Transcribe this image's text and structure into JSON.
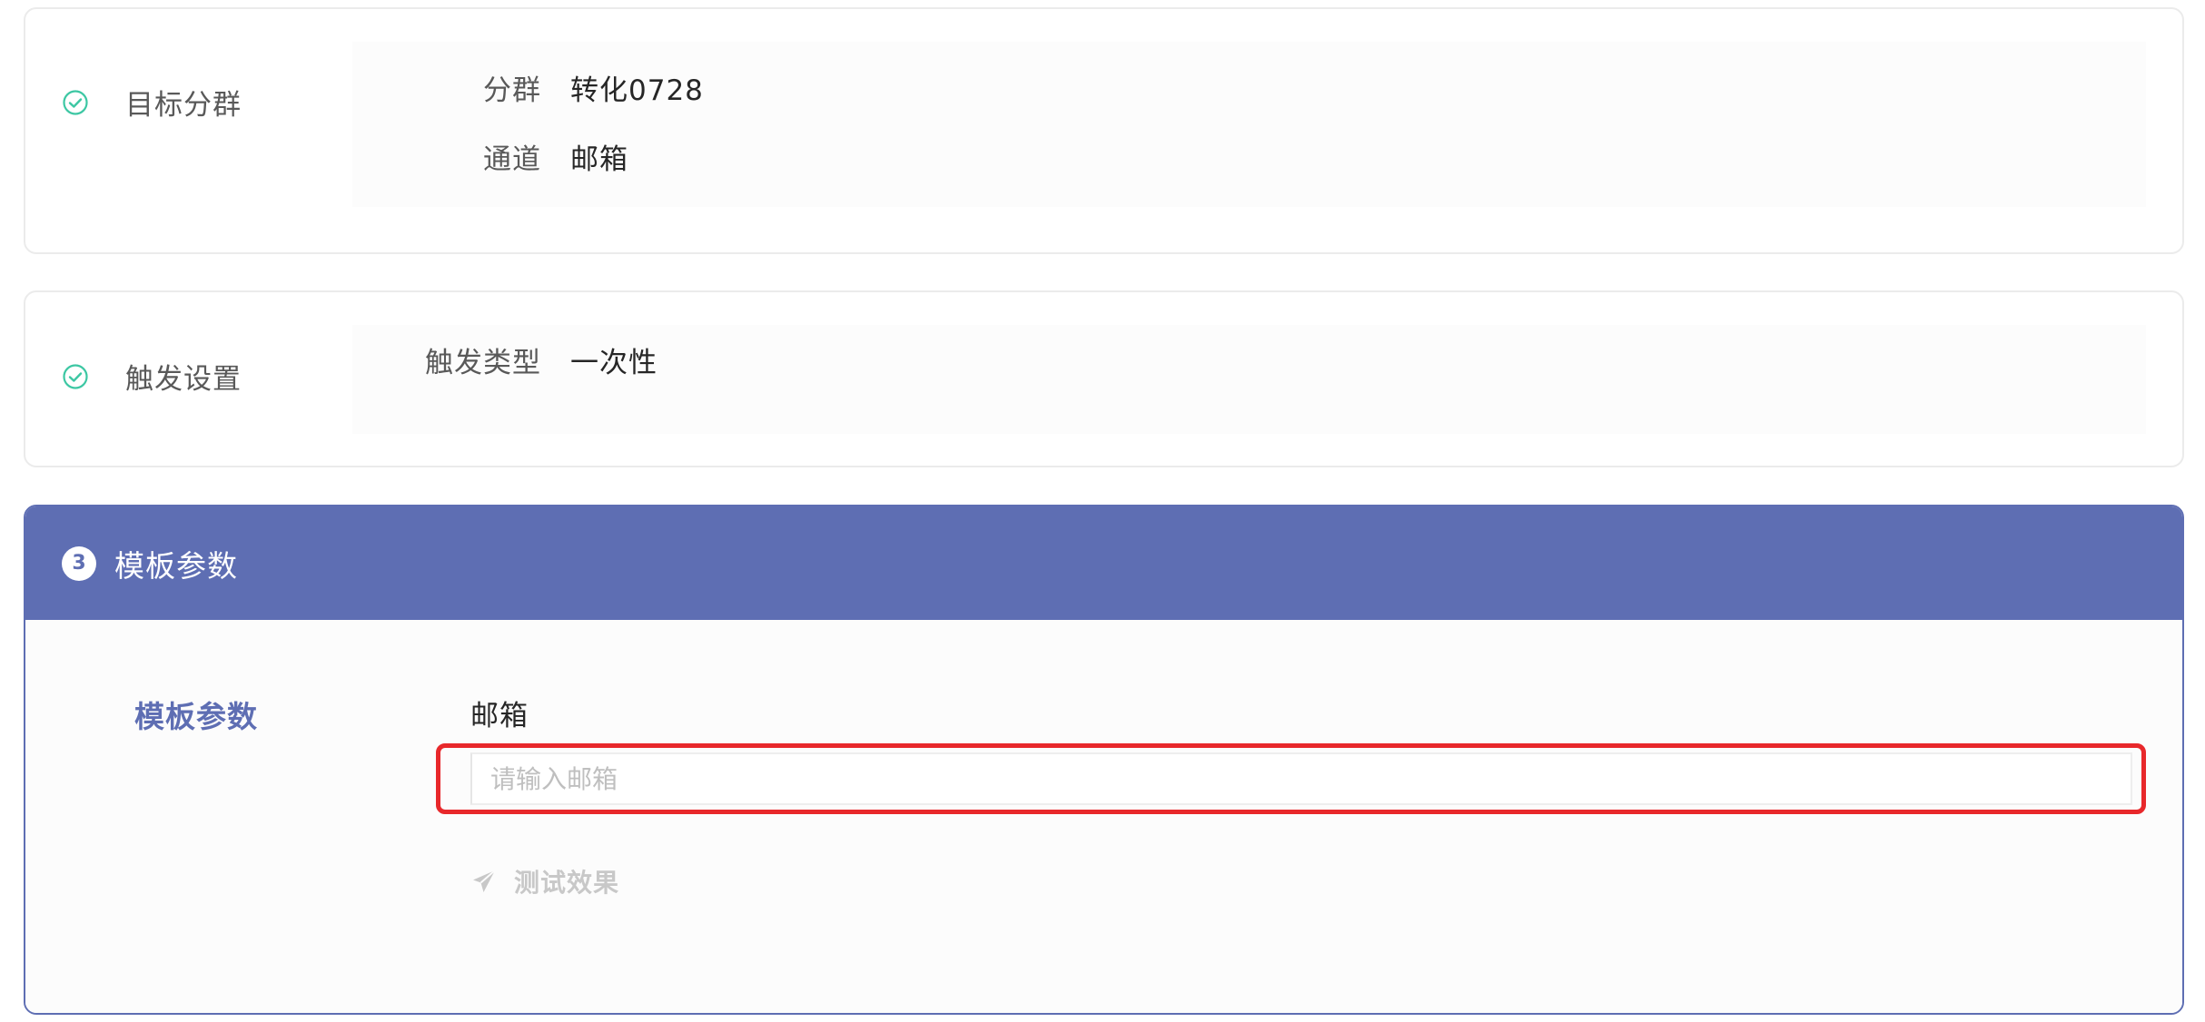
{
  "steps": [
    {
      "title": "目标分群",
      "status_icon": "check-circle-icon",
      "rows": [
        {
          "label": "分群",
          "value": "转化0728"
        },
        {
          "label": "通道",
          "value": "邮箱"
        }
      ]
    },
    {
      "title": "触发设置",
      "status_icon": "check-circle-icon",
      "rows": [
        {
          "label": "触发类型",
          "value": "一次性"
        }
      ]
    }
  ],
  "active_step": {
    "number": "3",
    "title": "模板参数",
    "side_label": "模板参数",
    "field_label": "邮箱",
    "input_placeholder": "请输入邮箱",
    "input_value": "",
    "test_button_label": "测试效果",
    "test_button_icon": "send-icon"
  },
  "colors": {
    "accent": "#5e6eb3",
    "success": "#3cc7a3",
    "highlight": "#e8282b",
    "disabled_text": "#c8c8c8"
  }
}
